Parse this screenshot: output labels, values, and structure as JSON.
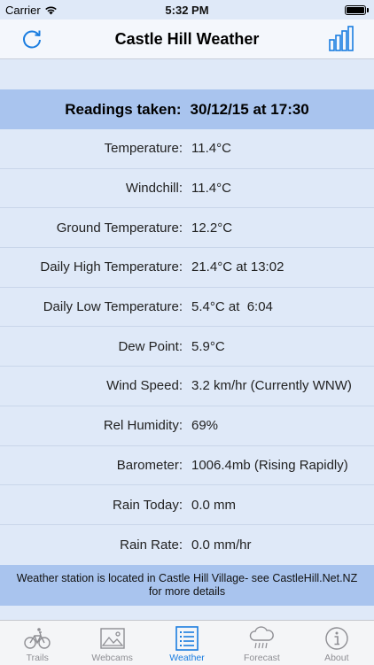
{
  "status_bar": {
    "carrier": "Carrier",
    "time": "5:32 PM"
  },
  "nav": {
    "title": "Castle Hill Weather",
    "left_icon": "refresh-icon",
    "right_icon": "bar-chart-icon"
  },
  "readings": {
    "label": "Readings taken:",
    "value": "30/12/15 at 17:30"
  },
  "rows": [
    {
      "label": "Temperature:",
      "value": "11.4°C"
    },
    {
      "label": "Windchill:",
      "value": "11.4°C"
    },
    {
      "label": "Ground Temperature:",
      "value": "12.2°C"
    },
    {
      "label": "Daily High Temperature:",
      "value": "21.4°C at 13:02"
    },
    {
      "label": "Daily Low Temperature:",
      "value": "5.4°C at  6:04"
    },
    {
      "label": "Dew Point:",
      "value": "5.9°C"
    },
    {
      "label": "Wind Speed:",
      "value": "3.2 km/hr (Currently WNW)"
    },
    {
      "label": "Rel Humidity:",
      "value": "69%"
    },
    {
      "label": "Barometer:",
      "value": "1006.4mb (Rising Rapidly)"
    },
    {
      "label": "Rain Today:",
      "value": "0.0 mm"
    },
    {
      "label": "Rain Rate:",
      "value": "0.0 mm/hr"
    }
  ],
  "info": "Weather station is located in Castle Hill Village- see CastleHill.Net.NZ for more details",
  "tabs": [
    {
      "label": "Trails",
      "icon": "bicycle-icon",
      "active": false
    },
    {
      "label": "Webcams",
      "icon": "photo-icon",
      "active": false
    },
    {
      "label": "Weather",
      "icon": "list-icon",
      "active": true
    },
    {
      "label": "Forecast",
      "icon": "cloud-rain-icon",
      "active": false
    },
    {
      "label": "About",
      "icon": "info-icon",
      "active": false
    }
  ],
  "colors": {
    "accent": "#1a7de0",
    "header_bg": "#a9c4ee",
    "page_bg": "#dfe9f8",
    "inactive": "#8e8e93"
  }
}
